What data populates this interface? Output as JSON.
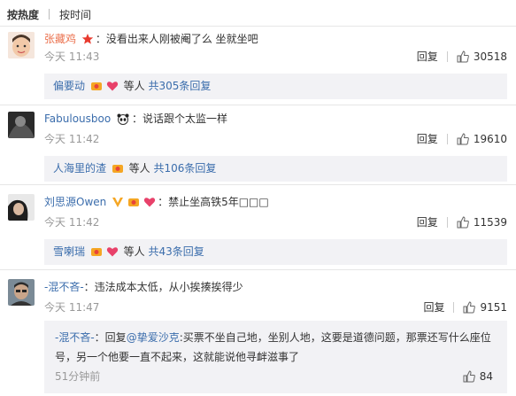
{
  "tabs": [
    {
      "label": "按热度",
      "active": true
    },
    {
      "label": "按时间",
      "active": false
    }
  ],
  "comments": [
    {
      "user": "张藏鸡",
      "text": "：没看出来人刚被阉了么 坐就坐吧",
      "time": "今天 11:43",
      "reply_label": "回复",
      "likes": "30518",
      "sub": {
        "names": "偏要动",
        "suffix": "等人",
        "count_link": "共305条回复"
      }
    },
    {
      "user": "Fabulousboo",
      "text": "：说话跟个太监一样",
      "time": "今天 11:42",
      "reply_label": "回复",
      "likes": "19610",
      "sub": {
        "names": "人海里的渣",
        "suffix": "等人",
        "count_link": "共106条回复"
      }
    },
    {
      "user": "刘思源Owen",
      "text": "：禁止坐高铁5年□□□",
      "time": "今天 11:42",
      "reply_label": "回复",
      "likes": "11539",
      "sub": {
        "names": "雪喇瑞",
        "suffix": "等人",
        "count_link": "共43条回复"
      }
    },
    {
      "user": "-混不吝-",
      "text": "：违法成本太低，从小挨揍挨得少",
      "time": "今天 11:47",
      "reply_label": "回复",
      "likes": "9151",
      "reply": {
        "user": "-混不吝-",
        "prefix": "：回复",
        "mention": "@挚爱沙克",
        "text_line1": ":买票不坐自己地，坐别人地，这要是道德问题，那票还写什么座位",
        "text_line2": "号，另一个他要一直不起来，这就能说他寻衅滋事了",
        "time": "51分钟前",
        "likes": "84"
      }
    }
  ],
  "colors": {
    "username": "#eb7350",
    "link": "#3b6dac",
    "meta": "#999999",
    "reply_bg": "#f2f2f5"
  }
}
